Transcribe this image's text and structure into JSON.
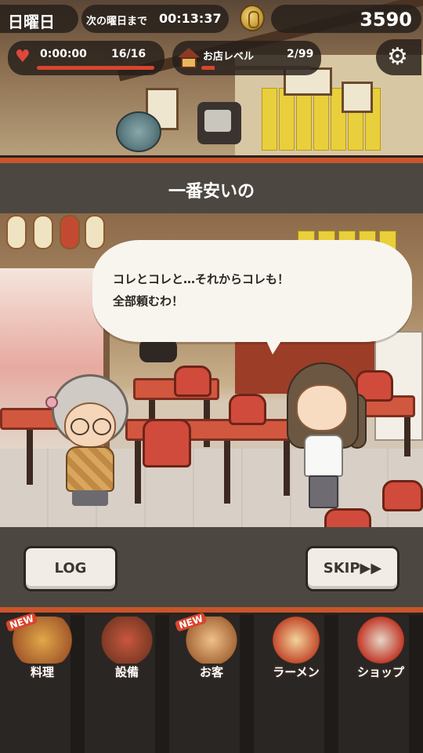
{
  "hud": {
    "day": "日曜日",
    "countdown_label": "次の曜日まで",
    "countdown_value": "00:13:37",
    "coins": "3590",
    "time_value": "0:00:00",
    "stamina_value": "16/16",
    "stamina_fraction": 1.0,
    "level_label": "お店レベル",
    "level_value": "2/99",
    "level_fraction": 0.12
  },
  "icons": {
    "heart": "♥",
    "gear": "⚙"
  },
  "dialogue": {
    "title": "一番安いの",
    "speech": "コレとコレと…それからコレも！\n全部頼むわ！"
  },
  "buttons": {
    "log": "LOG",
    "skip": "SKIP▶▶"
  },
  "nav": {
    "items": [
      {
        "label": "料理",
        "badge": "NEW"
      },
      {
        "label": "設備"
      },
      {
        "label": "お客",
        "badge": "NEW"
      },
      {
        "label": "ラーメン"
      },
      {
        "label": "ショップ"
      }
    ]
  },
  "colors": {
    "accent_red": "#d9452f",
    "panel": "#4d4741",
    "border_orange": "#c9552b"
  }
}
